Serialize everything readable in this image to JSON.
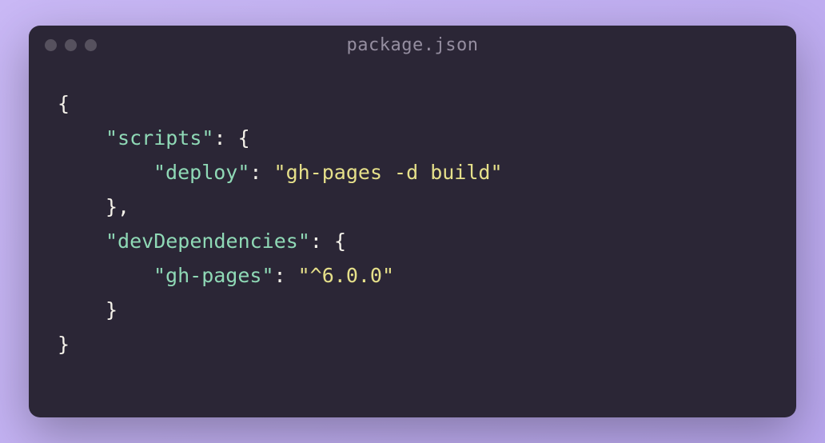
{
  "window": {
    "title": "package.json"
  },
  "code": {
    "brace_open": "{",
    "brace_close": "}",
    "scripts": {
      "key": "\"scripts\"",
      "colon_brace": ": {",
      "deploy_key": "\"deploy\"",
      "deploy_colon": ": ",
      "deploy_value": "\"gh-pages -d build\"",
      "close": "},"
    },
    "devDeps": {
      "key": "\"devDependencies\"",
      "colon_brace": ": {",
      "ghpages_key": "\"gh-pages\"",
      "ghpages_colon": ": ",
      "ghpages_value": "\"^6.0.0\"",
      "close": "}"
    }
  }
}
